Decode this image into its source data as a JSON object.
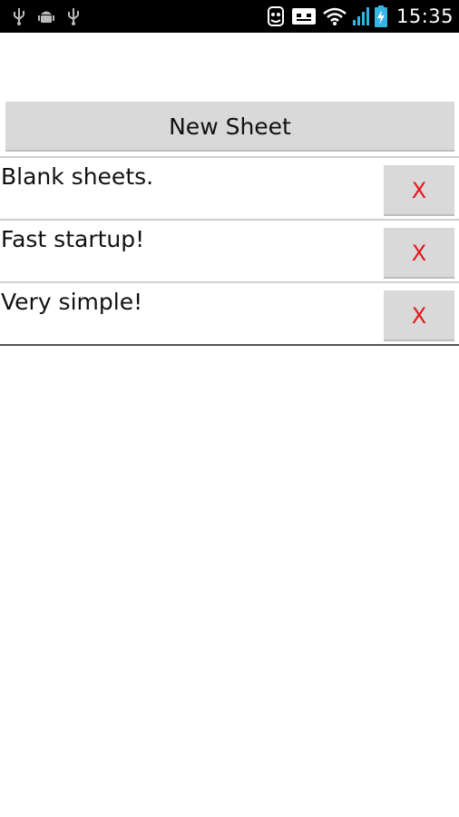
{
  "status_bar": {
    "time": "15:35",
    "left_icons": [
      "usb-icon",
      "android-debug-icon",
      "usb-icon"
    ],
    "right_icons": [
      "notification-app-icon",
      "voicemail-icon",
      "wifi-icon",
      "signal-icon",
      "battery-charging-icon"
    ],
    "battery_color": "#33b5e5"
  },
  "toolbar": {
    "new_sheet_label": "New Sheet"
  },
  "sheets": [
    {
      "label": "Blank sheets.",
      "delete_label": "X"
    },
    {
      "label": "Fast startup!",
      "delete_label": "X"
    },
    {
      "label": "Very simple!",
      "delete_label": "X"
    }
  ],
  "colors": {
    "delete_text": "#e8141a",
    "button_bg": "#d9d9d9"
  }
}
